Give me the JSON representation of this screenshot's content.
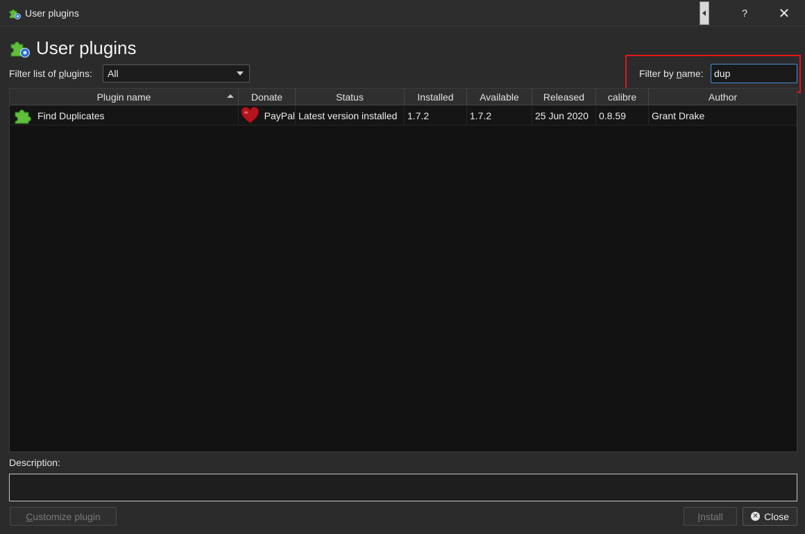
{
  "window": {
    "title": "User plugins",
    "help_label": "?",
    "close_label": "✕"
  },
  "header": {
    "title": "User plugins"
  },
  "filters": {
    "list_label_pre": "Filter list of ",
    "list_label_u": "p",
    "list_label_post": "lugins:",
    "list_value": "All",
    "name_label_pre": "Filter by ",
    "name_label_u": "n",
    "name_label_post": "ame:",
    "name_value": "dup"
  },
  "table": {
    "columns": [
      "Plugin name",
      "Donate",
      "Status",
      "Installed",
      "Available",
      "Released",
      "calibre",
      "Author"
    ],
    "rows": [
      {
        "name": "Find Duplicates",
        "donate": "PayPal",
        "status": "Latest version installed",
        "installed": "1.7.2",
        "available": "1.7.2",
        "released": "25 Jun 2020",
        "calibre": "0.8.59",
        "author": "Grant Drake"
      }
    ]
  },
  "description": {
    "label": "Description:",
    "text": ""
  },
  "buttons": {
    "customize_u": "C",
    "customize_rest": "ustomize plugin",
    "install_u": "I",
    "install_rest": "nstall",
    "close": "Close"
  },
  "colors": {
    "highlight_box": "#e8141a",
    "input_focus": "#4a90d9",
    "puzzle_green": "#5fbf3a"
  }
}
